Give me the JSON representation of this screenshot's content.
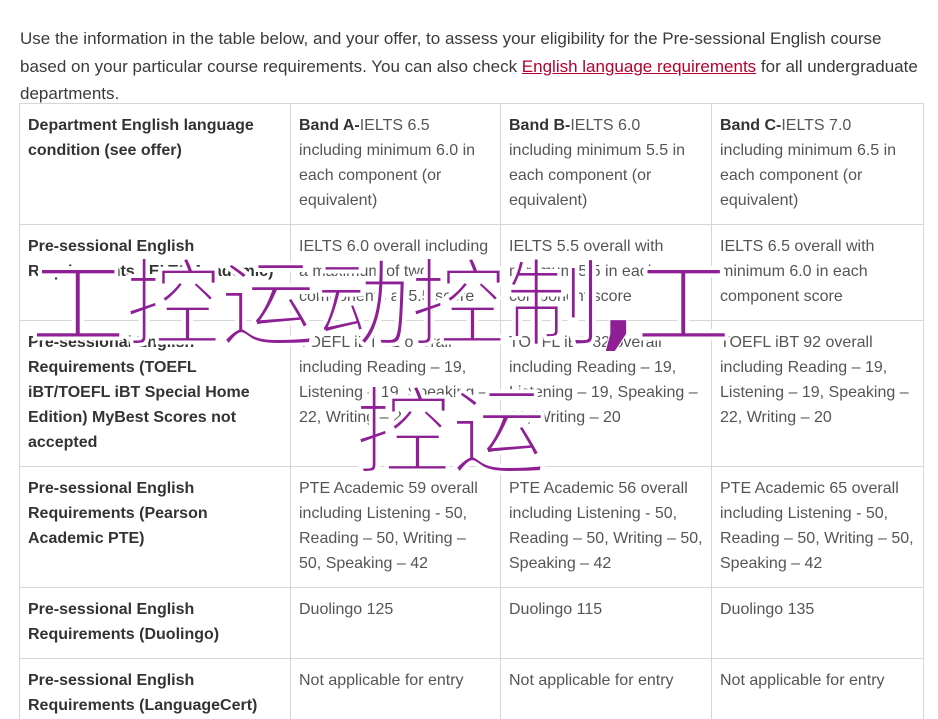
{
  "intro": {
    "text_before": "Use the information in the table below, and your offer, to assess your eligibility for the Pre-sessional English course based on your particular course requirements. You can also check ",
    "link_text": "English language requirements",
    "text_after": " for all undergraduate departments."
  },
  "table": {
    "header": {
      "col0": "Department English language condition (see offer)",
      "band_a_label": "Band A-",
      "band_a_text": "IELTS 6.5 including minimum 6.0 in each component (or equivalent)",
      "band_b_label": "Band B-",
      "band_b_text": "IELTS 6.0 including minimum 5.5 in each component (or equivalent)",
      "band_c_label": "Band C-",
      "band_c_text": "IELTS 7.0 including minimum 6.5 in each component (or equivalent)"
    },
    "rows": [
      {
        "label": "Pre-sessional English Requirements (IELTS Academic)",
        "a": "IELTS 6.0 overall including a maximum of two components at 5.5 score",
        "b": "IELTS 5.5 overall with minimum 5.5 in each component score",
        "c": "IELTS 6.5 overall with minimum 6.0 in each component score"
      },
      {
        "label": "Pre-sessional English Requirements (TOEFL iBT/TOEFL iBT Special Home Edition) MyBest Scores not accepted",
        "a": "TOEFL iBT 82 overall including Reading – 19, Listening – 19, Speaking – 22, Writing – 20",
        "b": "TOEFL iBT 82 overall including Reading – 19, Listening – 19, Speaking – 20, Writing – 20",
        "c": "TOEFL iBT 92 overall including Reading – 19, Listening – 19, Speaking – 22, Writing – 20"
      },
      {
        "label": "Pre-sessional English Requirements (Pearson Academic PTE)",
        "a": "PTE Academic 59 overall including Listening - 50, Reading – 50, Writing – 50, Speaking – 42",
        "b": "PTE Academic 56 overall including Listening - 50, Reading – 50, Writing – 50, Speaking – 42",
        "c": "PTE Academic 65 overall including Listening - 50, Reading – 50, Writing – 50, Speaking – 42"
      },
      {
        "label": "Pre-sessional English Requirements (Duolingo)",
        "a": "Duolingo 125",
        "b": "Duolingo 115",
        "c": "Duolingo 135"
      },
      {
        "label": "Pre-sessional English Requirements (LanguageCert)",
        "a": "Not applicable for entry",
        "b": "Not applicable for entry",
        "c": "Not applicable for entry"
      }
    ]
  },
  "watermark": {
    "line1": "工控运动控制,工",
    "line2": "控运",
    "color": "#8e1f95"
  }
}
